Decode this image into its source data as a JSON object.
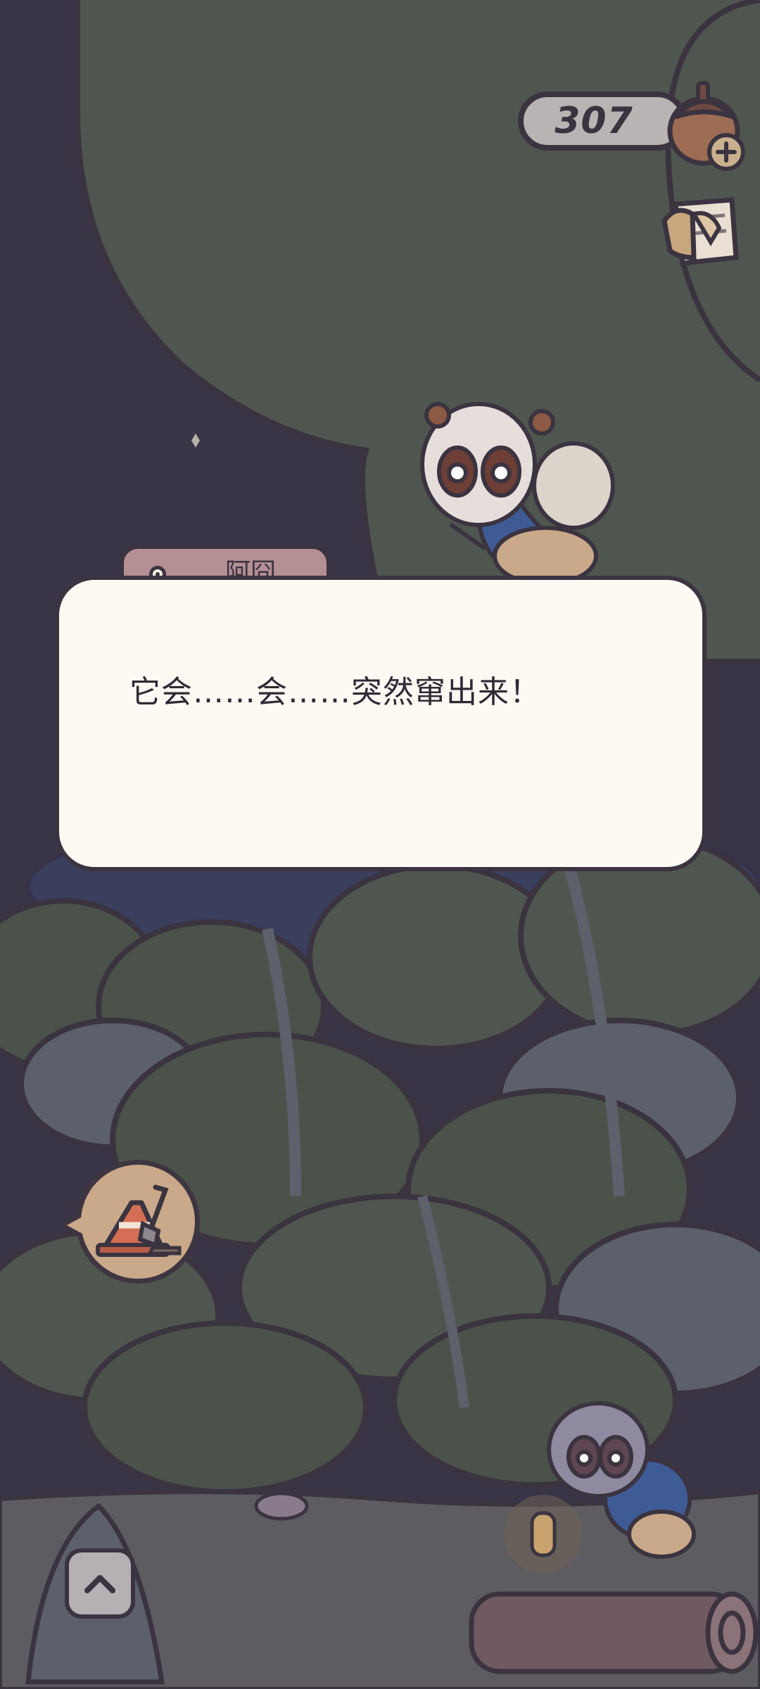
{
  "currency": {
    "value": "307",
    "icon": "acorn-plus-icon"
  },
  "dialog": {
    "speaker": "阿囧",
    "text": "它会……会……突然窜出来！"
  },
  "buttons": {
    "notes_icon": "notebook-icon",
    "dig_icon": "traffic-cone-shovel-icon",
    "expand_icon": "chevron-up-icon"
  },
  "colors": {
    "night_sky": "#3a3447",
    "tree_canopy": "#4f564f",
    "dialog_bg": "#fdf9f3",
    "name_tab": "#b48f93",
    "outline": "#3b3440"
  }
}
